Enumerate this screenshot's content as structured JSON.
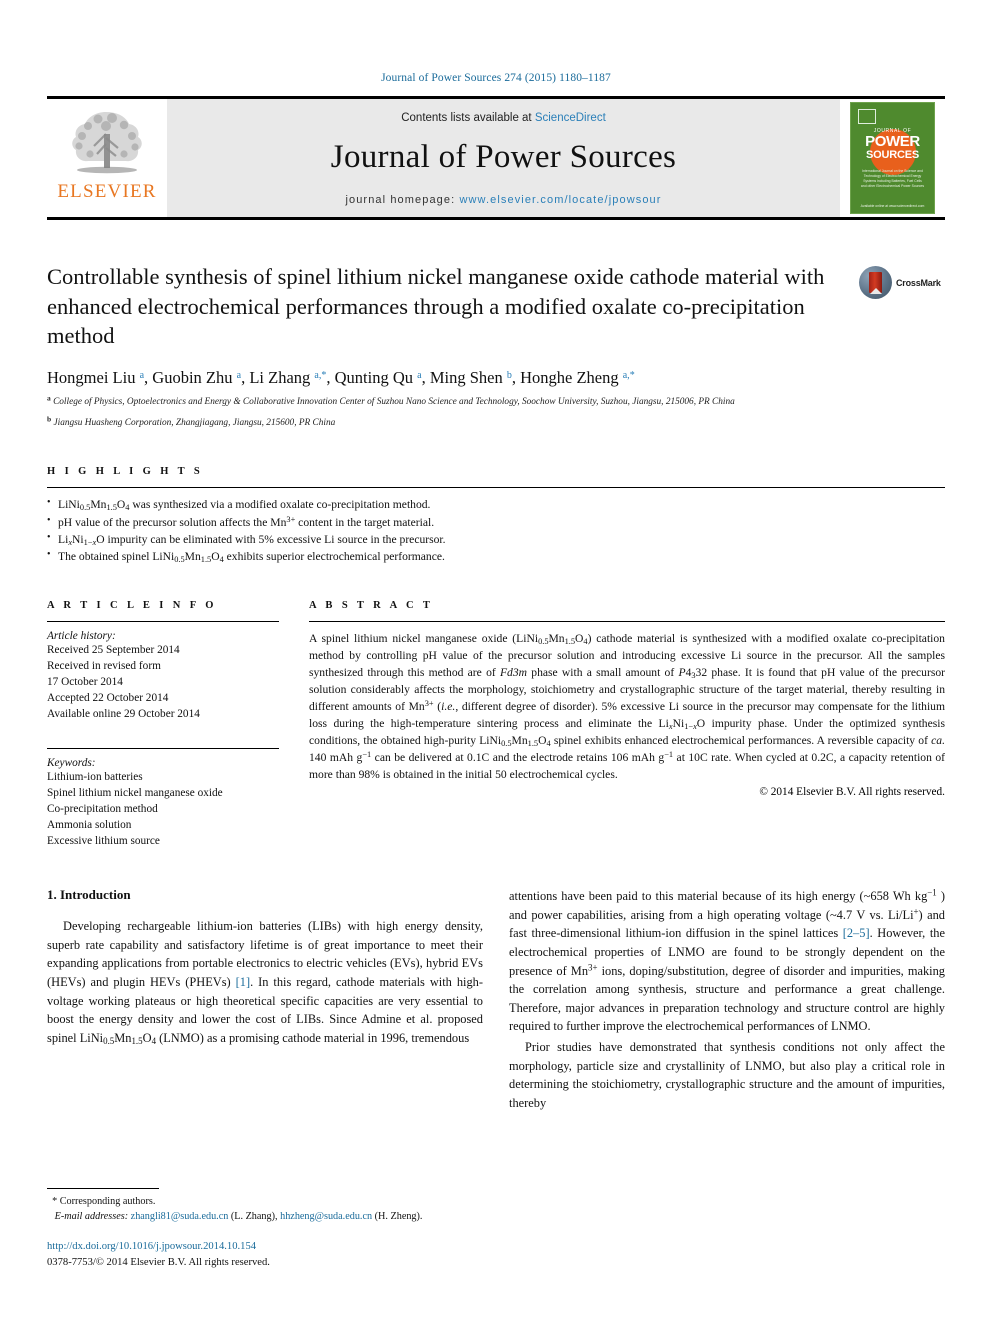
{
  "running_head": "Journal of Power Sources 274 (2015) 1180–1187",
  "masthead": {
    "contents_prefix": "Contents lists available at ",
    "sciencedirect": "ScienceDirect",
    "journal_title": "Journal of Power Sources",
    "homepage_prefix": "journal homepage: ",
    "homepage_url": "www.elsevier.com/locate/jpowsour",
    "publisher_wordmark": "ELSEVIER",
    "publisher_color": "#E87722",
    "cover": {
      "journal_of": "JOURNAL OF",
      "power": "POWER",
      "sources": "SOURCES",
      "subtitle": "International Journal on the Science and Technology of Electrochemical Energy Systems including Batteries, Fuel Cells and other Electrochemical Power Sources",
      "footer": "Available online at www.sciencedirect.com",
      "bg_color": "#4f8a2e",
      "accent_color": "#e8601c"
    }
  },
  "article": {
    "title": "Controllable synthesis of spinel lithium nickel manganese oxide cathode material with enhanced electrochemical performances through a modified oxalate co-precipitation method",
    "crossmark_label": "CrossMark",
    "authors": [
      {
        "name": "Hongmei Liu",
        "aff": "a",
        "star": false
      },
      {
        "name": "Guobin Zhu",
        "aff": "a",
        "star": false
      },
      {
        "name": "Li Zhang",
        "aff": "a",
        "star": true
      },
      {
        "name": "Qunting Qu",
        "aff": "a",
        "star": false
      },
      {
        "name": "Ming Shen",
        "aff": "b",
        "star": false
      },
      {
        "name": "Honghe Zheng",
        "aff": "a",
        "star": true
      }
    ],
    "affiliations": [
      {
        "mark": "a",
        "text": "College of Physics, Optoelectronics and Energy & Collaborative Innovation Center of Suzhou Nano Science and Technology, Soochow University, Suzhou, Jiangsu, 215006, PR China"
      },
      {
        "mark": "b",
        "text": "Jiangsu Huasheng Corporation, Zhangjiagang, Jiangsu, 215600, PR China"
      }
    ]
  },
  "highlights": {
    "heading": "H I G H L I G H T S",
    "items": [
      "LiNi0.5Mn1.5O4 was synthesized via a modified oxalate co-precipitation method.",
      "pH value of the precursor solution affects the Mn3+ content in the target material.",
      "LixNi1−xO impurity can be eliminated with 5% excessive Li source in the precursor.",
      "The obtained spinel LiNi0.5Mn1.5O4 exhibits superior electrochemical performance."
    ]
  },
  "article_info": {
    "heading": "A R T I C L E  I N F O",
    "history_label": "Article history:",
    "history": [
      "Received 25 September 2014",
      "Received in revised form",
      "17 October 2014",
      "Accepted 22 October 2014",
      "Available online 29 October 2014"
    ],
    "keywords_label": "Keywords:",
    "keywords": [
      "Lithium-ion batteries",
      "Spinel lithium nickel manganese oxide",
      "Co-precipitation method",
      "Ammonia solution",
      "Excessive lithium source"
    ]
  },
  "abstract": {
    "heading": "A B S T R A C T",
    "copyright": "© 2014 Elsevier B.V. All rights reserved."
  },
  "introduction": {
    "number_and_title": "1.  Introduction"
  },
  "footnote": {
    "corresponding": "Corresponding authors.",
    "email_label": "E-mail addresses:",
    "email1": "zhangli81@suda.edu.cn",
    "email1_owner": "(L. Zhang),",
    "email2": "hhzheng@suda.edu.cn",
    "email2_owner": "(H. Zheng).",
    "doi": "http://dx.doi.org/10.1016/j.jpowsour.2014.10.154",
    "issn": "0378-7753/© 2014 Elsevier B.V. All rights reserved.",
    "link_color": "#1a6b9a"
  }
}
